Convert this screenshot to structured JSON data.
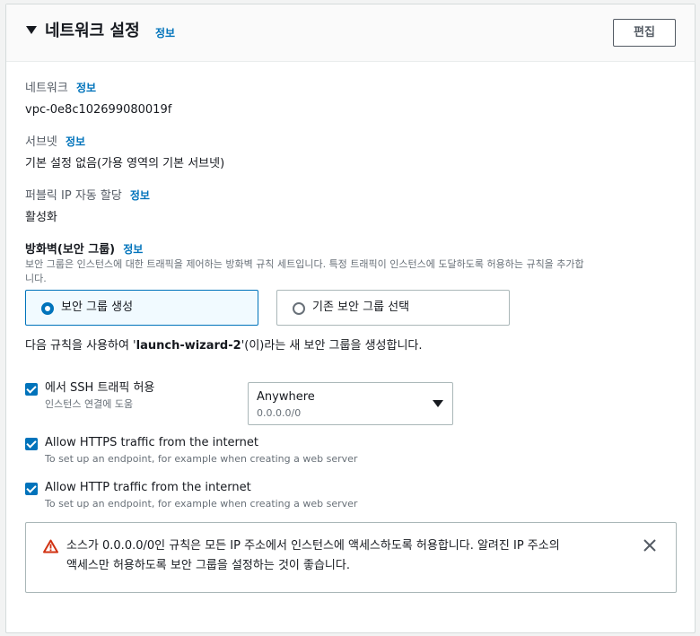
{
  "header": {
    "title": "네트워크 설정",
    "info": "정보",
    "edit_label": "편집"
  },
  "network": {
    "label": "네트워크",
    "info": "정보",
    "value": "vpc-0e8c102699080019f"
  },
  "subnet": {
    "label": "서브넷",
    "info": "정보",
    "value": "기본 설정 없음(가용 영역의 기본 서브넷)"
  },
  "public_ip": {
    "label": "퍼블릭 IP 자동 할당",
    "info": "정보",
    "value": "활성화"
  },
  "firewall": {
    "label": "방화벽(보안 그룹)",
    "info": "정보",
    "description_line1": "보안 그룹은 인스턴스에 대한 트래픽을 제어하는 방화벽 규칙 세트입니다. 특정 트래픽이 인스턴스에 도달하도록 허용하는 규칙을 추가합",
    "description_line2": "니다.",
    "options": [
      "보안 그룹 생성",
      "기존 보안 그룹 선택"
    ],
    "selected": "보안 그룹 생성",
    "create_note_prefix": "다음 규칙을 사용하여 '",
    "create_note_name": "launch-wizard-2",
    "create_note_suffix": "'(이)라는 새 보안 그룹을 생성합니다."
  },
  "rules": [
    {
      "label": "에서 SSH 트래픽 허용",
      "description": "인스턴스 연결에 도움",
      "checked": true
    },
    {
      "label": "Allow HTTPS traffic from the internet",
      "description": "To set up an endpoint, for example when creating a web server",
      "checked": true
    },
    {
      "label": "Allow HTTP traffic from the internet",
      "description": "To set up an endpoint, for example when creating a web server",
      "checked": true
    }
  ],
  "ssh_source": {
    "value": "Anywhere",
    "sub": "0.0.0.0/0"
  },
  "warning": {
    "line1": "소스가 0.0.0.0/0인 규칙은 모든 IP 주소에서 인스턴스에 액세스하도록 허용합니다. 알려진 IP 주소의",
    "line2": "액세스만 허용하도록 보안 그룹을 설정하는 것이 좋습니다."
  },
  "colors": {
    "accent": "#0073bb",
    "warning": "#d13212",
    "border": "#aab7b8"
  }
}
